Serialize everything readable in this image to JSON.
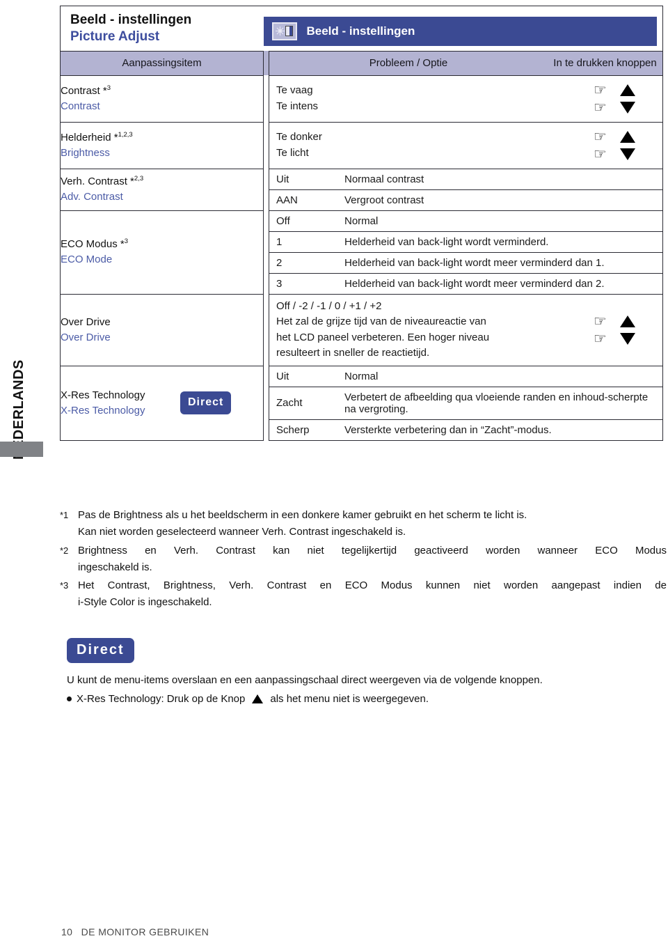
{
  "language_tab": {
    "label": "NEDERLANDS"
  },
  "header": {
    "title_nl": "Beeld - instellingen",
    "title_en": "Picture Adjust",
    "banner_title": "Beeld - instellingen",
    "banner_icon": "brightness-contrast-icon",
    "banner_color": "#3b4a93"
  },
  "table": {
    "columns": {
      "item": "Aanpassingsitem",
      "problem": "Probleem / Optie",
      "buttons": "In te drukken knoppen"
    },
    "rows": [
      {
        "item_nl": "Contrast",
        "item_nl_sup": "3",
        "item_en": "Contrast",
        "problems": [
          "Te vaag",
          "Te intens"
        ],
        "buttons": true
      },
      {
        "item_nl": "Helderheid",
        "item_nl_sup": "1,2,3",
        "item_en": "Brightness",
        "problems": [
          "Te donker",
          "Te licht"
        ],
        "buttons": true
      },
      {
        "item_nl": "Verh. Contrast",
        "item_nl_sup": "2,3",
        "item_en": "Adv. Contrast",
        "options": [
          {
            "opt": "Uit",
            "desc": "Normaal contrast"
          },
          {
            "opt": "AAN",
            "desc": "Vergroot contrast"
          }
        ],
        "buttons": false
      },
      {
        "item_nl": "ECO Modus",
        "item_nl_sup": "3",
        "item_en": "ECO Mode",
        "options": [
          {
            "opt": "Off",
            "desc": "Normal"
          },
          {
            "opt": "1",
            "desc": "Helderheid van back-light wordt verminderd."
          },
          {
            "opt": "2",
            "desc": "Helderheid van back-light wordt meer verminderd dan 1."
          },
          {
            "opt": "3",
            "desc": "Helderheid van back-light wordt meer verminderd dan 2."
          }
        ],
        "buttons": false
      },
      {
        "item_nl": "Over Drive",
        "item_nl_sup": "",
        "item_en": "Over Drive",
        "paragraph": "Off / -2 / -1 / 0 / +1 / +2\nHet zal de grijze tijd van de niveaureactie van het LCD paneel verbeteren. Een hoger niveau resulteert in sneller de reactietijd.",
        "paragraph_lines": [
          "Off / -2 / -1 / 0 / +1 / +2",
          "Het zal de grijze tijd van de niveaureactie van",
          "het LCD paneel verbeteren. Een hoger niveau",
          "resulteert in sneller de reactietijd."
        ],
        "buttons": true
      },
      {
        "item_nl": "X-Res Technology",
        "item_nl_sup": "",
        "item_en": "X-Res Technology",
        "badge": "Direct",
        "options": [
          {
            "opt": "Uit",
            "desc": "Normal"
          },
          {
            "opt": "Zacht",
            "desc": "Verbetert de afbeelding qua vloeiende randen en inhoud-scherpte na vergroting."
          },
          {
            "opt": "Scherp",
            "desc": "Versterkte verbetering dan in “Zacht”-modus."
          }
        ],
        "buttons": false
      }
    ]
  },
  "notes": [
    {
      "mark": "*1",
      "lines": [
        "Pas de Brightness als u het beeldscherm in een donkere kamer gebruikt en het scherm te licht is.",
        "Kan niet worden geselecteerd wanneer Verh. Contrast ingeschakeld is."
      ]
    },
    {
      "mark": "*2",
      "lines": [
        "Brightness en Verh. Contrast kan niet tegelijkertijd geactiveerd worden wanneer ECO Modus",
        "ingeschakeld is."
      ]
    },
    {
      "mark": "*3",
      "lines": [
        "Het Contrast, Brightness, Verh. Contrast en ECO Modus kunnen niet worden aangepast indien de",
        "i-Style Color is ingeschakeld."
      ]
    }
  ],
  "direct_block": {
    "badge": "Direct",
    "intro": "U kunt de menu-items overslaan en een aanpassingschaal direct weergeven via de volgende knoppen.",
    "bullet_before": "X-Res Technology: Druk op de Knop",
    "bullet_after": "als het menu niet is weergegeven."
  },
  "footer": {
    "page_number": "10",
    "section": "DE MONITOR GEBRUIKEN"
  }
}
